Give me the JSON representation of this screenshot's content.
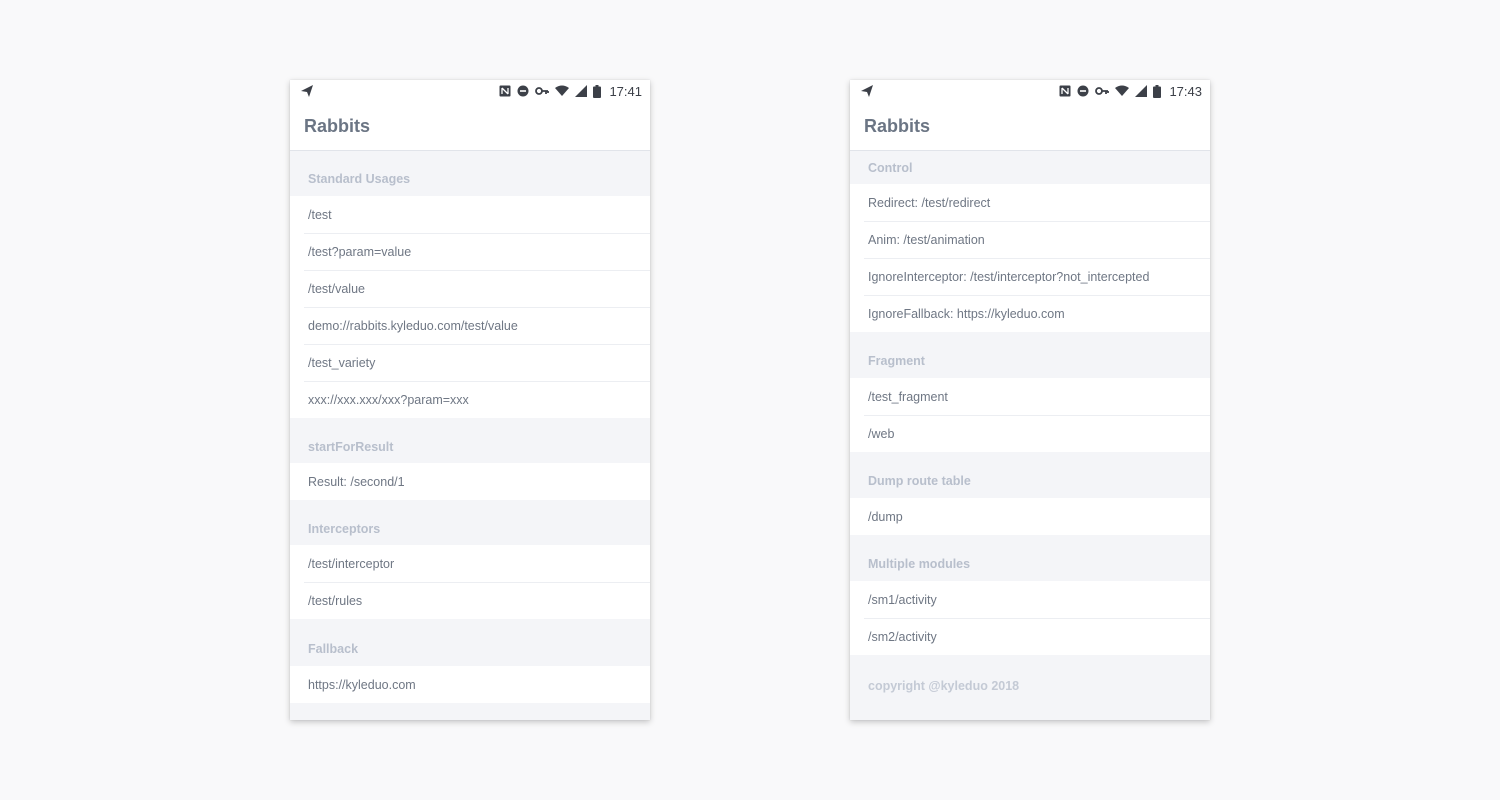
{
  "left": {
    "status": {
      "time": "17:41"
    },
    "title": "Rabbits",
    "sections": [
      {
        "header": "Standard Usages",
        "items": [
          "/test",
          "/test?param=value",
          "/test/value",
          "demo://rabbits.kyleduo.com/test/value",
          "/test_variety",
          "xxx://xxx.xxx/xxx?param=xxx"
        ]
      },
      {
        "header": "startForResult",
        "items": [
          "Result: /second/1"
        ]
      },
      {
        "header": "Interceptors",
        "items": [
          "/test/interceptor",
          "/test/rules"
        ]
      },
      {
        "header": "Fallback",
        "items": [
          "https://kyleduo.com"
        ]
      }
    ]
  },
  "right": {
    "status": {
      "time": "17:43"
    },
    "title": "Rabbits",
    "sections": [
      {
        "header": "Control",
        "items": [
          "Redirect: /test/redirect",
          "Anim: /test/animation",
          "IgnoreInterceptor: /test/interceptor?not_intercepted",
          "IgnoreFallback: https://kyleduo.com"
        ]
      },
      {
        "header": "Fragment",
        "items": [
          "/test_fragment",
          "/web"
        ]
      },
      {
        "header": "Dump route table",
        "items": [
          "/dump"
        ]
      },
      {
        "header": "Multiple modules",
        "items": [
          "/sm1/activity",
          "/sm2/activity"
        ]
      }
    ],
    "footer": "copyright @kyleduo 2018"
  },
  "icons": [
    "send-icon",
    "nfc-icon",
    "do-not-disturb-icon",
    "vpn-key-icon",
    "wifi-icon",
    "cell-signal-icon",
    "battery-icon"
  ]
}
